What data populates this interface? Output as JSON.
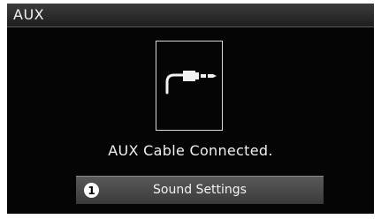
{
  "header": {
    "title": "AUX"
  },
  "main": {
    "icon": "aux-cable-icon",
    "status": "AUX Cable Connected.",
    "button": {
      "number": "1",
      "label": "Sound Settings"
    }
  },
  "colors": {
    "background": "#050505",
    "text": "#f0f0f0",
    "button": "#4a4a4a"
  }
}
